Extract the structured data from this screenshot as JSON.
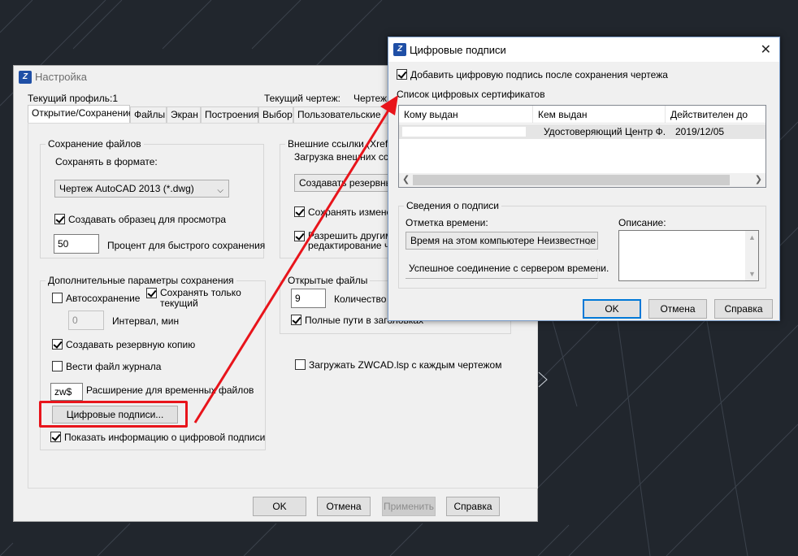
{
  "settings": {
    "title": "Настройка",
    "current_profile": "Текущий профиль:1",
    "current_drawing": "Текущий чертеж:",
    "current_drawing_value": "Чертеж",
    "tabs": [
      "Открытие/Сохранение",
      "Файлы",
      "Экран",
      "Построения",
      "Выбор",
      "Пользовательские"
    ],
    "file_saving": {
      "legend": "Сохранение файлов",
      "save_as_label": "Сохранять в формате:",
      "save_as_value": "Чертеж AutoCAD 2013 (*.dwg)",
      "create_preview": "Создавать образец для просмотра",
      "quick_save_value": "50",
      "quick_save_label": "Процент для быстрого сохранения"
    },
    "extra_save": {
      "legend": "Дополнительные параметры сохранения",
      "autosave": "Автосохранение",
      "save_current_only": "Сохранять только текущий",
      "interval_value": "0",
      "interval_label": "Интервал, мин",
      "create_backup": "Создавать резервную копию",
      "log_file": "Вести файл журнала",
      "temp_ext_value": "zw$",
      "temp_ext_label": "Расширение для временных файлов",
      "digital_signatures_button": "Цифровые подписи...",
      "show_signature_info": "Показать информацию о цифровой подписи"
    },
    "xrefs": {
      "legend": "Внешние ссылки (Xrefs)",
      "load_label": "Загрузка внешних ссыл",
      "load_value": "Создавать резервные",
      "save_changes": "Сохранять изменени",
      "allow_others_line1": "Разрешить другим п",
      "allow_others_line2": "редактирование чер"
    },
    "open_files": {
      "legend": "Открытые файлы",
      "count_value": "9",
      "count_label": "Количество",
      "full_paths": "Полные пути в заголовках"
    },
    "load_lsp": "Загружать ZWCAD.lsp с каждым чертежом",
    "buttons": {
      "ok": "OK",
      "cancel": "Отмена",
      "apply": "Применить",
      "help": "Справка"
    }
  },
  "digsig": {
    "title": "Цифровые подписи",
    "add_signature": "Добавить цифровую подпись после сохранения чертежа",
    "cert_list_label": "Список цифровых сертификатов",
    "columns": [
      "Кому выдан",
      "Кем выдан",
      "Действителен до"
    ],
    "rows": [
      {
        "issued_to": "",
        "issued_by": "Удостоверяющий Центр Ф...",
        "valid_until": "2019/12/05"
      }
    ],
    "sig_info": {
      "legend": "Сведения о подписи",
      "timestamp_label": "Отметка времени:",
      "timestamp_value": "Время на этом компьютере Неизвестное",
      "status": "Успешное соединение с сервером времени.",
      "description_label": "Описание:"
    },
    "buttons": {
      "ok": "OK",
      "cancel": "Отмена",
      "help": "Справка"
    }
  },
  "colors": {
    "annotation": "#e8141b",
    "background": "#21262d",
    "accent": "#0078d7"
  },
  "icons": [
    "app-icon",
    "close-icon",
    "chevron-down-icon",
    "scroll-arrow-icon"
  ]
}
